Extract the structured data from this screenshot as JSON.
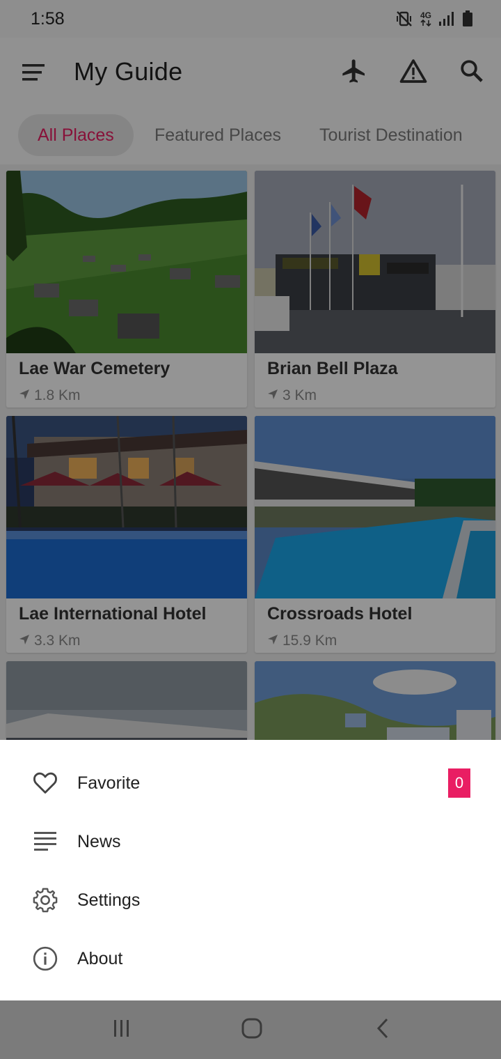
{
  "status_bar": {
    "time": "1:58",
    "network": "4G",
    "icons": [
      "mute-vibrate-icon",
      "network-4g-icon",
      "signal-icon",
      "battery-icon"
    ]
  },
  "app_bar": {
    "title": "My Guide",
    "icons": [
      "menu-icon",
      "airplane-icon",
      "warning-icon",
      "search-icon"
    ]
  },
  "tabs": [
    {
      "label": "All Places",
      "active": true
    },
    {
      "label": "Featured Places",
      "active": false
    },
    {
      "label": "Tourist Destination",
      "active": false
    }
  ],
  "places": [
    {
      "name": "Lae War Cemetery",
      "distance": "1.8 Km"
    },
    {
      "name": "Brian Bell Plaza",
      "distance": "3 Km"
    },
    {
      "name": "Lae International Hotel",
      "distance": "3.3 Km"
    },
    {
      "name": "Crossroads Hotel",
      "distance": "15.9 Km"
    }
  ],
  "sheet": {
    "items": [
      {
        "label": "Favorite",
        "icon": "heart-icon",
        "badge": "0"
      },
      {
        "label": "News",
        "icon": "news-icon"
      },
      {
        "label": "Settings",
        "icon": "gear-icon"
      },
      {
        "label": "About",
        "icon": "info-icon"
      }
    ]
  },
  "nav_bar": {
    "icons": [
      "recent-apps-icon",
      "home-icon",
      "back-icon"
    ]
  },
  "colors": {
    "accent": "#e91e63",
    "scrim": "#000000"
  }
}
